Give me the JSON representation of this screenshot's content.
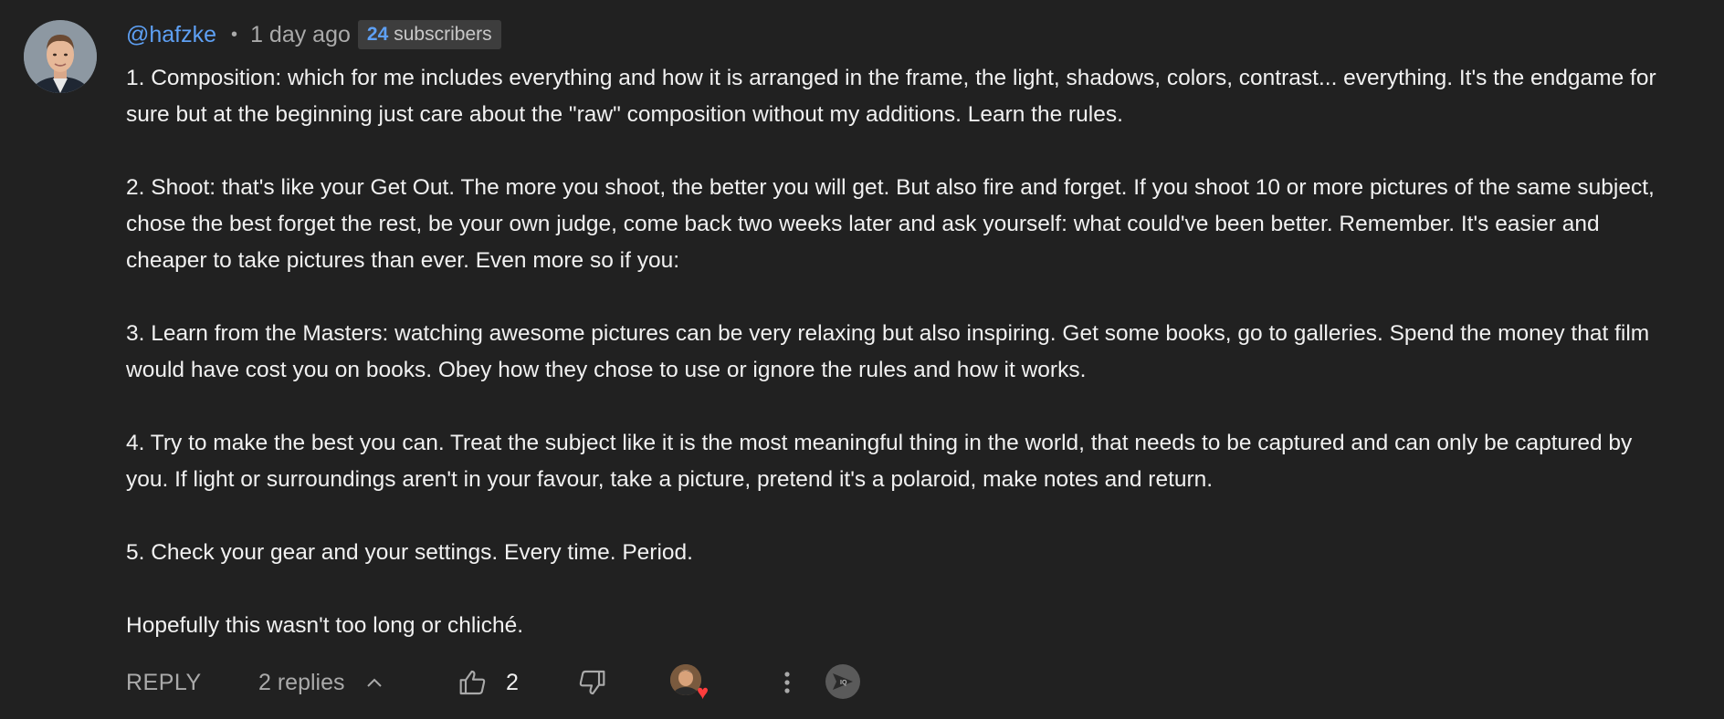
{
  "comment": {
    "author": "@hafzke",
    "separator": "•",
    "time": "1 day ago",
    "subscribers": {
      "count": "24",
      "label": "subscribers"
    },
    "paragraphs": [
      "1. Composition: which for me includes everything and how it is arranged in the frame, the light, shadows, colors, contrast... everything. It's the endgame for sure but at the beginning just care about the \"raw\" composition without my additions. Learn the rules.",
      "2. Shoot: that's like your Get Out. The more you shoot, the better you will get. But also fire and forget. If you shoot 10 or more pictures of the same subject, chose the best forget the rest, be your own judge, come back two weeks later and ask yourself: what could've been better. Remember. It's easier and cheaper to take pictures than ever. Even more so if you:",
      "3. Learn from the Masters: watching awesome pictures can be very relaxing but also inspiring. Get some books, go to galleries. Spend the money that film would have cost you on books. Obey how they chose to use or ignore the rules and how it works.",
      "4. Try to make the best you can. Treat the subject like it is the most meaningful thing in the world, that needs to be captured and can only be captured by you. If light or surroundings aren't in your favour, take a picture, pretend it's a polaroid, make notes and return.",
      "5. Check your gear and your settings. Every time. Period.",
      "Hopefully this wasn't too long or chliché."
    ]
  },
  "actions": {
    "reply_label": "REPLY",
    "replies_label": "2 replies",
    "like_count": "2",
    "creator_heart": true,
    "extension_label": "IQ"
  },
  "icons": {
    "replies_toggle": "chevron-up-icon",
    "like": "thumbs-up-icon",
    "dislike": "thumbs-down-icon",
    "creator_heart": "creator-heart-icon",
    "more": "more-vertical-icon",
    "extension": "extension-icon"
  },
  "colors": {
    "background": "#212121",
    "author_link": "#5ea0f4",
    "heart": "#ff3d3d"
  }
}
